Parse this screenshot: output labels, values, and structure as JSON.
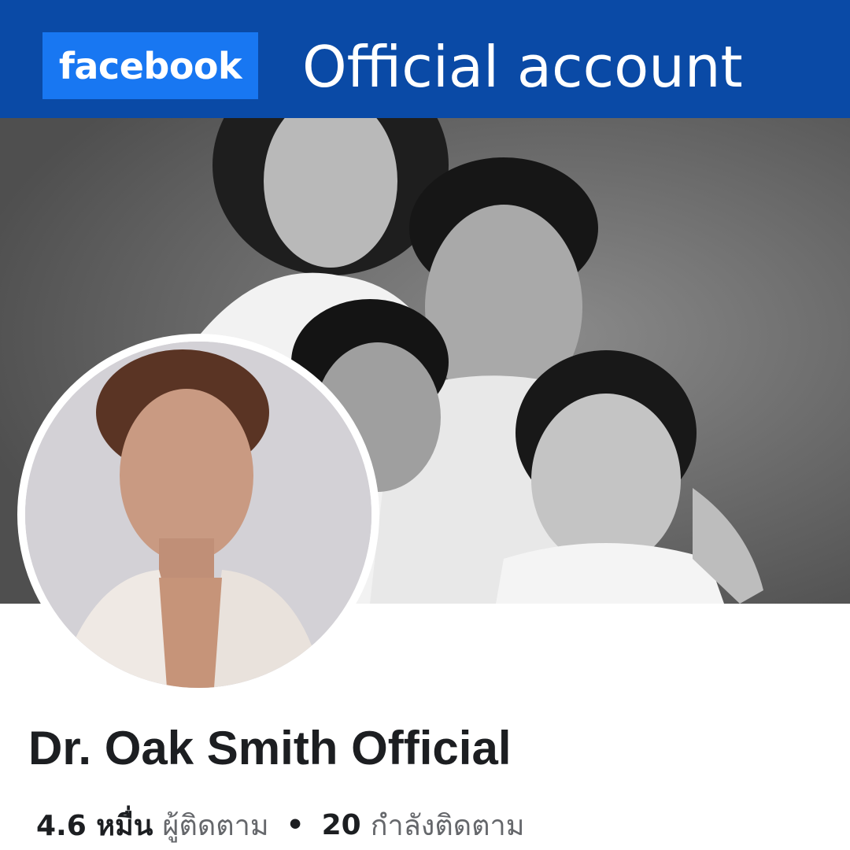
{
  "header": {
    "brand_label": "facebook",
    "title": "Official account"
  },
  "page": {
    "name": "Dr. Oak Smith Official"
  },
  "stats": {
    "followers_count": "4.6 หมื่น",
    "followers_label": "ผู้ติดตาม",
    "separator": "•",
    "following_count": "20",
    "following_label": "กำลังติดตาม"
  },
  "colors": {
    "header_bg": "#0a4aa6",
    "brand_badge": "#1877f2",
    "name_text": "#1c1e21",
    "muted_text": "#65676b"
  }
}
